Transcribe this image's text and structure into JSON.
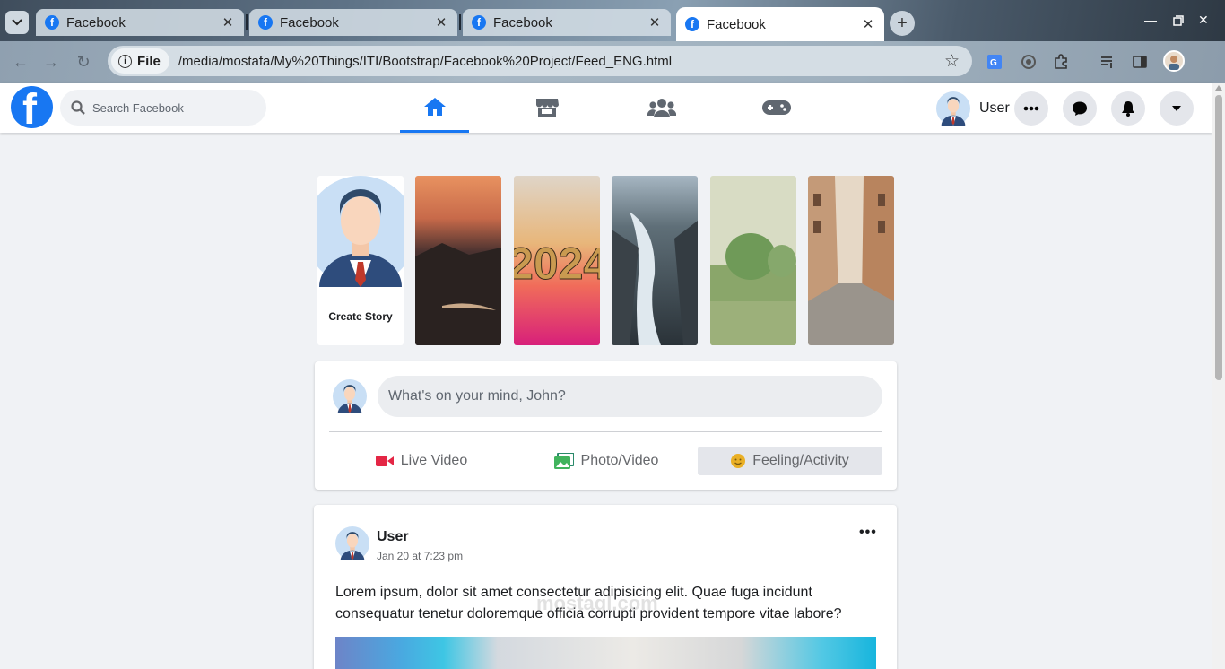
{
  "browser": {
    "tabs": [
      {
        "title": "Facebook",
        "active": false
      },
      {
        "title": "Facebook",
        "active": false
      },
      {
        "title": "Facebook",
        "active": false
      },
      {
        "title": "Facebook",
        "active": true
      }
    ],
    "file_chip": "File",
    "url": "/media/mostafa/My%20Things/ITI/Bootstrap/Facebook%20Project/Feed_ENG.html"
  },
  "header": {
    "logo_letter": "f",
    "search_placeholder": "Search Facebook",
    "user_name": "User",
    "nav": [
      "home",
      "marketplace",
      "groups",
      "gaming"
    ]
  },
  "stories": {
    "create_label": "Create Story",
    "items": [
      "mountain-sunset",
      "2024",
      "waterfall",
      "green-field",
      "old-town-street"
    ]
  },
  "composer": {
    "placeholder": "What's on your mind, John?",
    "actions": [
      {
        "label": "Live Video",
        "color": "#e42645"
      },
      {
        "label": "Photo/Video",
        "color": "#41b35d"
      },
      {
        "label": "Feeling/Activity",
        "color": "#eab026"
      }
    ]
  },
  "post": {
    "author": "User",
    "time": "Jan 20 at 7:23 pm",
    "more": "•••",
    "text": "Lorem ipsum, dolor sit amet consectetur adipisicing elit. Quae fuga incidunt consequatur tenetur doloremque officia corrupti provident tempore vitae labore?"
  },
  "watermark": "mostaql.com",
  "colors": {
    "brand": "#1877f2",
    "page_bg": "#f0f2f5"
  }
}
